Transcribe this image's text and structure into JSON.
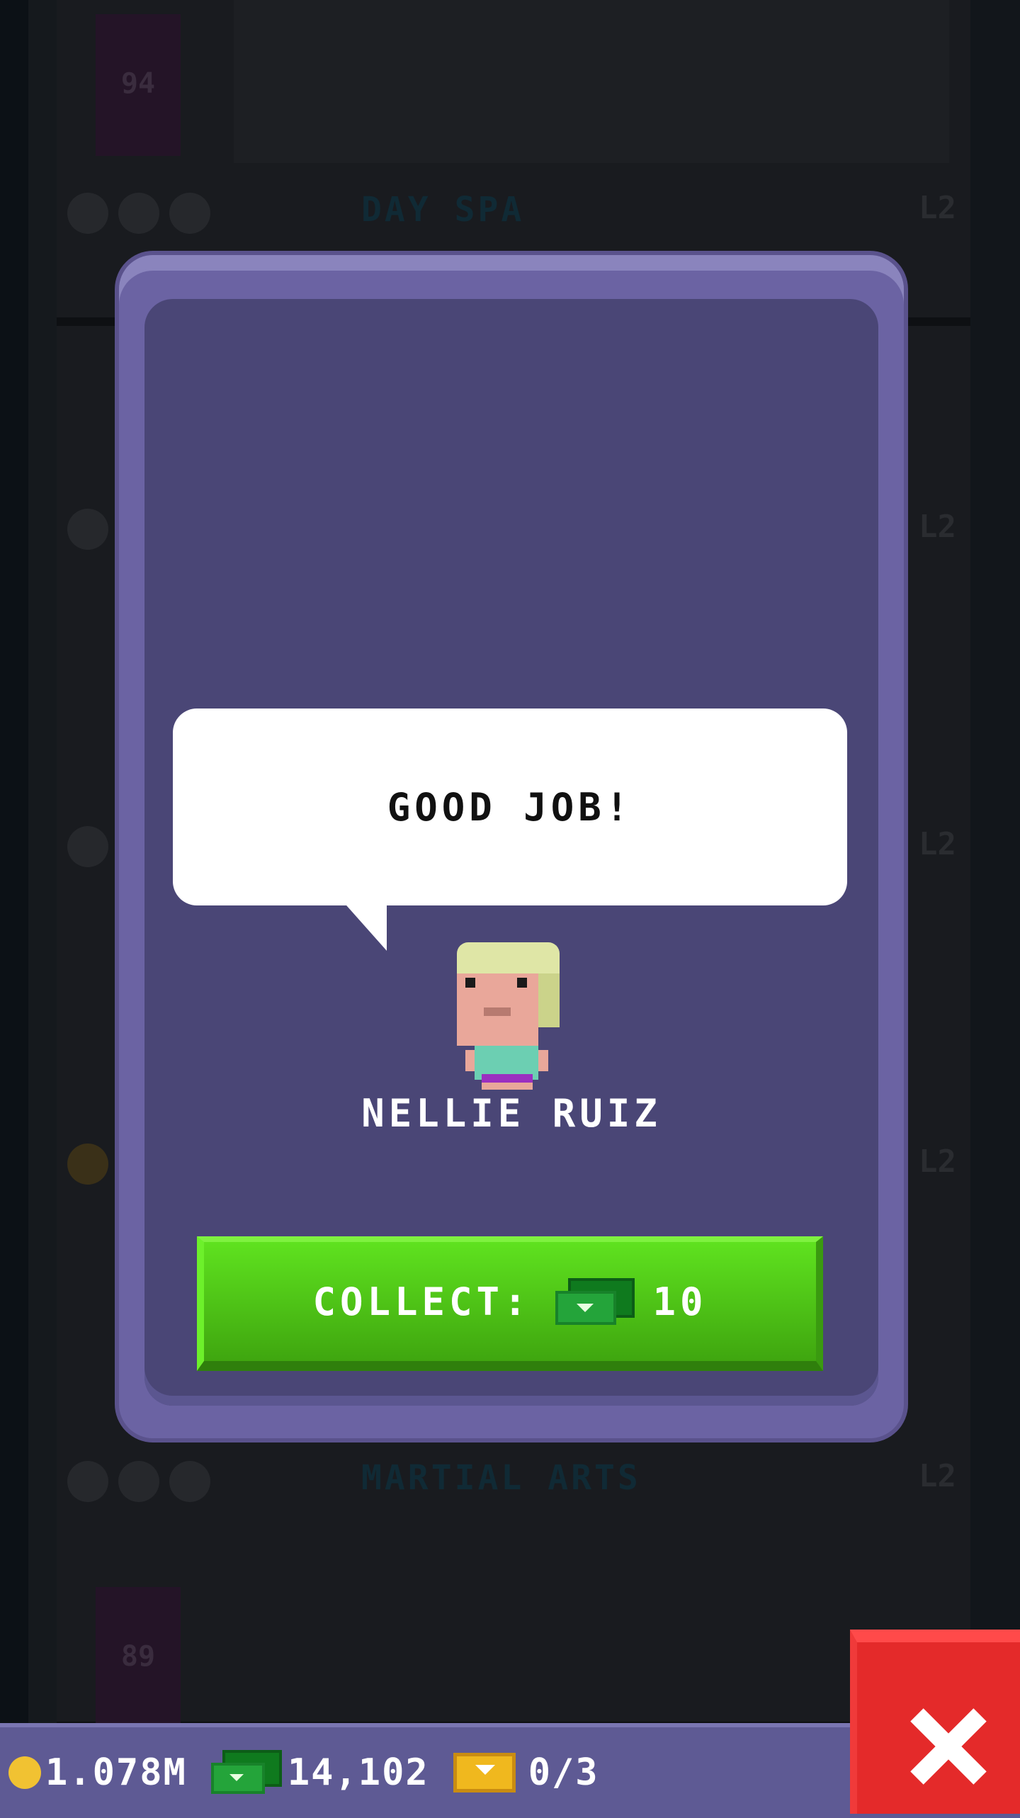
{
  "background": {
    "floors": [
      {
        "number": "94",
        "name": ""
      },
      {
        "number": "",
        "name": "DAY SPA",
        "level": "L2"
      },
      {
        "number": "",
        "name": "",
        "level": "L2"
      },
      {
        "number": "",
        "name": "",
        "level": "L2"
      },
      {
        "number": "",
        "name": "",
        "level": "L2"
      },
      {
        "number": "89",
        "name": "MARTIAL ARTS",
        "level": "L2"
      }
    ]
  },
  "dialog": {
    "speech": "GOOD JOB!",
    "character_name": "NELLIE RUIZ",
    "collect": {
      "label": "COLLECT:",
      "currency_icon": "bux-icon",
      "amount": "10"
    }
  },
  "status_bar": {
    "coins": "1.078M",
    "bux": "14,102",
    "tickets": "0/3"
  },
  "close_button": {
    "icon": "close-icon"
  },
  "colors": {
    "card": "#6b63a3",
    "card_inner": "#4a4676",
    "collect_button": "#4fc517",
    "close_button": "#e42a2a",
    "bar": "#5e5a94"
  }
}
